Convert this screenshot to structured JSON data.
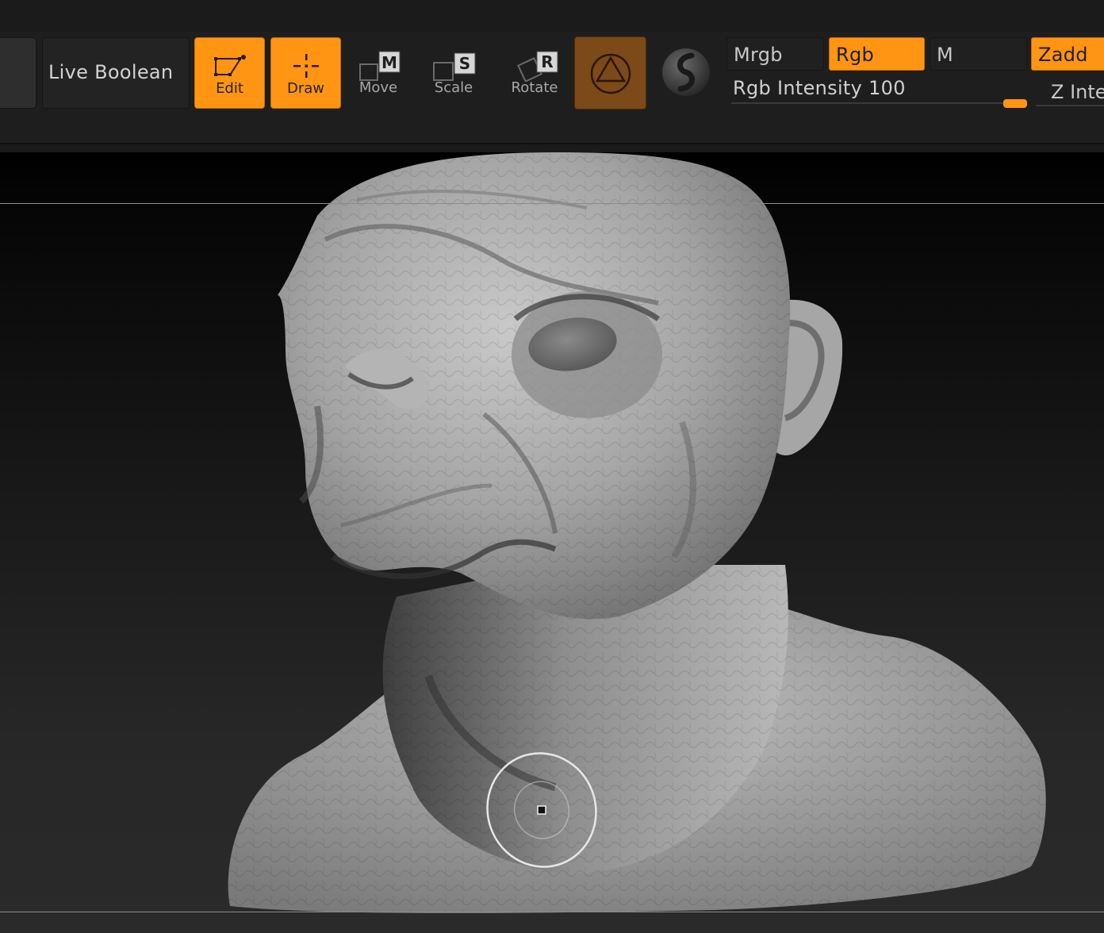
{
  "toolbar": {
    "live_boolean_label": "Live Boolean",
    "edit_label": "Edit",
    "draw_label": "Draw",
    "move_label": "Move",
    "move_key": "M",
    "scale_label": "Scale",
    "scale_key": "S",
    "rotate_label": "Rotate",
    "rotate_key": "R",
    "modes": {
      "mrgb": "Mrgb",
      "rgb": "Rgb",
      "m": "M",
      "zadd": "Zadd"
    },
    "rgb_intensity_label": "Rgb Intensity",
    "rgb_intensity_value": "100",
    "z_intensity_label": "Z Inter"
  },
  "colors": {
    "accent": "#ff9512",
    "accent_dim": "#7b4a18",
    "panel": "#252525",
    "background": "#1e1e1e"
  },
  "icons": {
    "edit": "edit-transpose-icon",
    "draw": "draw-crosshair-icon",
    "move": "move-icon",
    "scale": "scale-icon",
    "rotate": "rotate-icon",
    "gizmo": "gizmo-3d-icon",
    "material": "material-sphere-icon",
    "brush": "brush-cursor-icon"
  }
}
